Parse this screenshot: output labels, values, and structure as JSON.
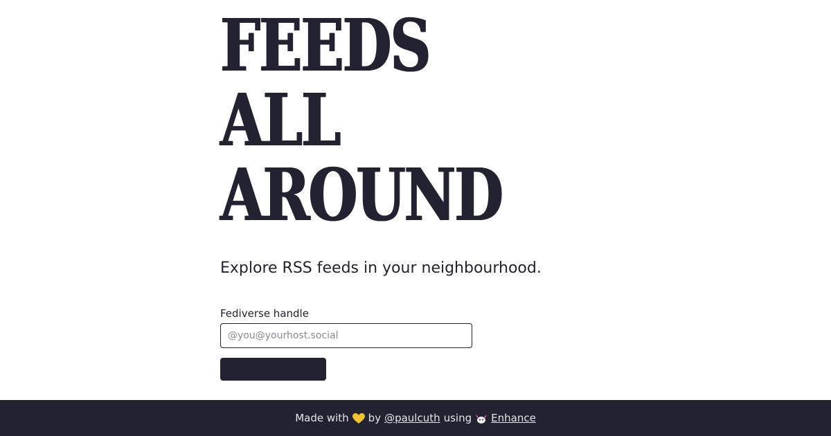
{
  "hero": {
    "lines": [
      "FEEDS",
      "ALL",
      "AROUND"
    ]
  },
  "tagline": "Explore RSS feeds in your neighbourhood.",
  "form": {
    "label": "Fediverse handle",
    "placeholder": "@you@yourhost.social",
    "value": "",
    "submit_label": ""
  },
  "footer": {
    "made_with": "Made with",
    "heart_icon": "yellow-heart-icon",
    "by": "by",
    "author_link": "@paulcuth",
    "using": "using",
    "framework_icon": "enhance-axol-icon",
    "framework_link": "Enhance"
  },
  "colors": {
    "ink": "#222230",
    "background": "#ffffff",
    "footer_text": "#e6e6ea",
    "heart": "#f2c230"
  }
}
